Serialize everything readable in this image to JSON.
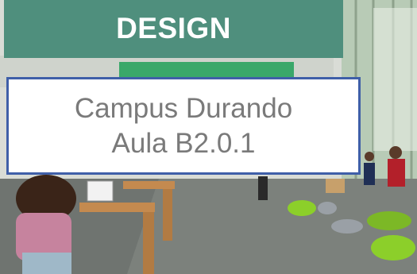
{
  "banner": {
    "title": "DESIGN",
    "color": "#4f8f7d"
  },
  "label": {
    "line1": "Campus Durando",
    "line2": "Aula B2.0.1",
    "border_color": "#3f5fa8"
  },
  "photo": {
    "description_icon": "library-interior-photo"
  }
}
